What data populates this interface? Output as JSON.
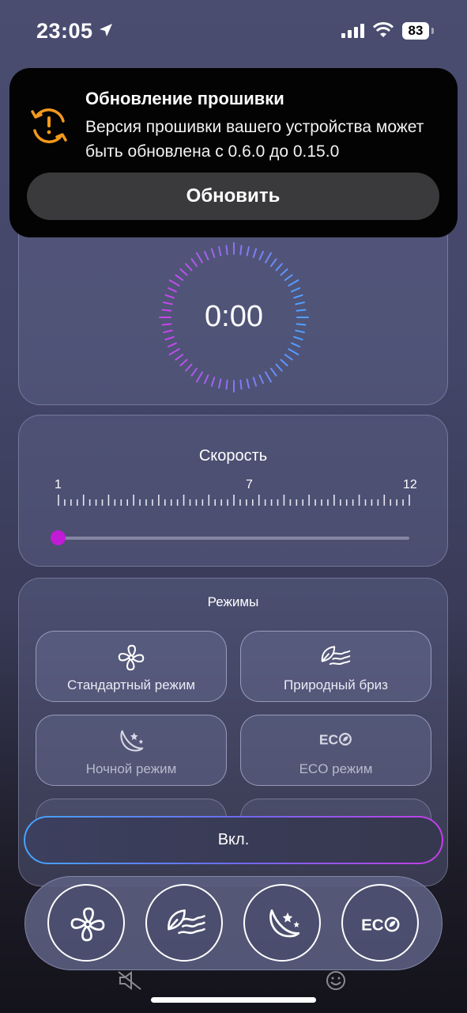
{
  "status_bar": {
    "time": "23:05",
    "battery": "83"
  },
  "notification": {
    "title": "Обновление прошивки",
    "body": "Версия прошивки вашего устройства может быть обновлена с 0.6.0 до 0.15.0",
    "button_label": "Обновить",
    "accent_color": "#f39a1c"
  },
  "timer": {
    "value": "0:00"
  },
  "speed": {
    "title": "Скорость",
    "min_label": "1",
    "mid_label": "7",
    "max_label": "12",
    "current": 1,
    "thumb_color": "#c21bd6"
  },
  "modes": {
    "title": "Режимы",
    "items": [
      {
        "label": "Стандартный режим",
        "icon": "fan-icon"
      },
      {
        "label": "Природный бриз",
        "icon": "leaf-wind-icon"
      },
      {
        "label": "Ночной режим",
        "icon": "moon-stars-icon"
      },
      {
        "label": "ECO режим",
        "icon": "eco-icon"
      }
    ]
  },
  "power_button": {
    "label": "Вкл."
  },
  "dock": {
    "items": [
      "fan-icon",
      "leaf-wind-icon",
      "moon-stars-icon",
      "eco-icon"
    ]
  }
}
